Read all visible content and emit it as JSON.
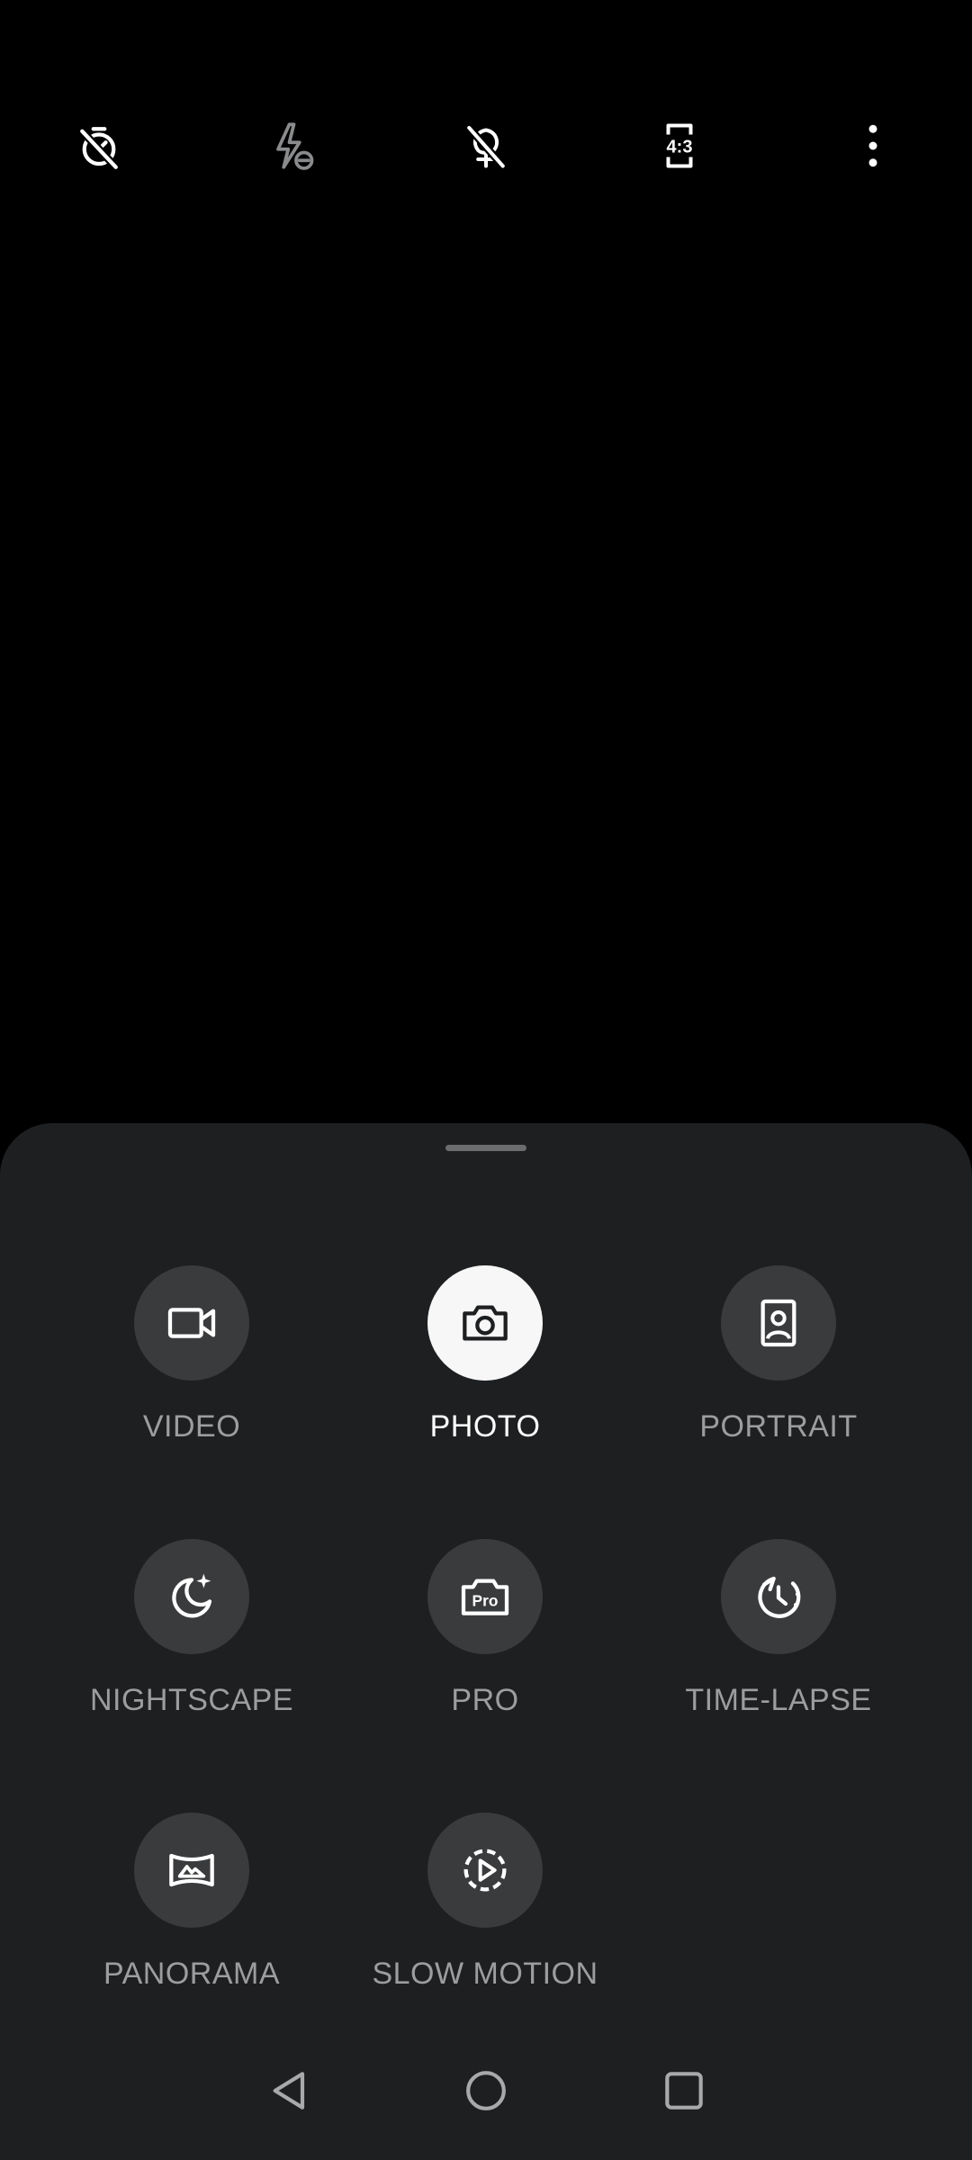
{
  "toolbar": {
    "items": [
      {
        "name": "timer-off",
        "icon": "timer-off-icon"
      },
      {
        "name": "flash-off",
        "icon": "flash-off-icon"
      },
      {
        "name": "filter-off",
        "icon": "filter-off-icon"
      },
      {
        "name": "aspect-ratio",
        "icon": "aspect-ratio-icon",
        "label": "4:3"
      },
      {
        "name": "more-options",
        "icon": "more-vert-icon"
      }
    ]
  },
  "modes": {
    "video": {
      "label": "VIDEO",
      "icon": "video-camera-icon"
    },
    "photo": {
      "label": "PHOTO",
      "icon": "photo-camera-icon",
      "active": true
    },
    "portrait": {
      "label": "PORTRAIT",
      "icon": "portrait-icon"
    },
    "nightscape": {
      "label": "NIGHTSCAPE",
      "icon": "moon-stars-icon"
    },
    "pro": {
      "label": "PRO",
      "icon": "pro-camera-icon",
      "badge": "Pro"
    },
    "timelapse": {
      "label": "TIME-LAPSE",
      "icon": "timelapse-icon"
    },
    "panorama": {
      "label": "PANORAMA",
      "icon": "panorama-icon"
    },
    "slowmotion": {
      "label": "SLOW MOTION",
      "icon": "slow-motion-icon"
    }
  },
  "colors": {
    "sheet_background": "#1e1f21",
    "mode_circle": "#3a3b3d",
    "active_mode_circle": "#f7f7f7",
    "inactive_label": "#9c9d9f",
    "active_label": "#ffffff"
  },
  "nav": {
    "back": {
      "icon": "back-triangle-icon"
    },
    "home": {
      "icon": "home-circle-icon"
    },
    "recents": {
      "icon": "recents-square-icon"
    }
  }
}
